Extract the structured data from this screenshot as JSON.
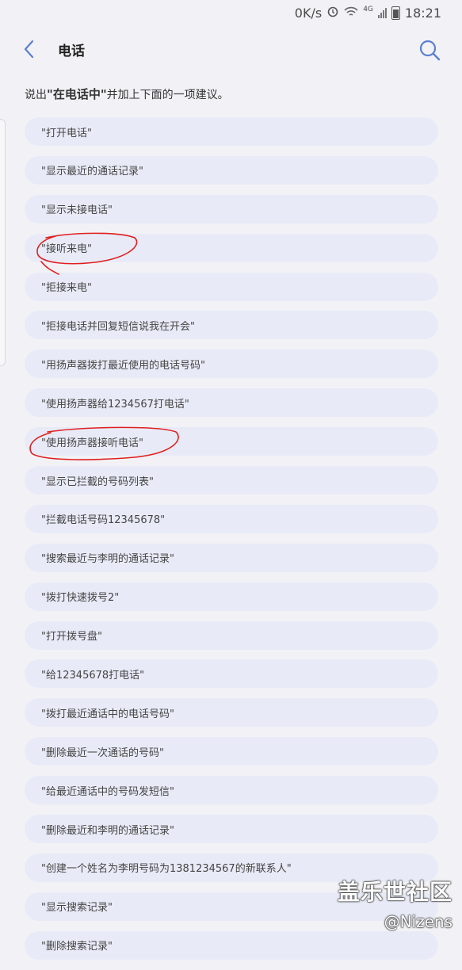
{
  "status": {
    "speed": "0K/s",
    "network": "4G",
    "time": "18:21"
  },
  "header": {
    "title": "电话"
  },
  "hint": {
    "prefix": "说出",
    "keyword": "\"在电话中\"",
    "suffix": "并加上下面的一项建议。"
  },
  "suggestions": [
    "\"打开电话\"",
    "\"显示最近的通话记录\"",
    "\"显示未接电话\"",
    "\"接听来电\"",
    "\"拒接来电\"",
    "\"拒接电话并回复短信说我在开会\"",
    "\"用扬声器拨打最近使用的电话号码\"",
    "\"使用扬声器给1234567打电话\"",
    "\"使用扬声器接听电话\"",
    "\"显示已拦截的号码列表\"",
    "\"拦截电话号码12345678\"",
    "\"搜索最近与李明的通话记录\"",
    "\"拨打快速拨号2\"",
    "\"打开拨号盘\"",
    "\"给12345678打电话\"",
    "\"拨打最近通话中的电话号码\"",
    "\"删除最近一次通话的号码\"",
    "\"给最近通话中的号码发短信\"",
    "\"删除最近和李明的通话记录\"",
    "\"创建一个姓名为李明号码为1381234567的新联系人\"",
    "\"显示搜索记录\"",
    "\"删除搜索记录\""
  ],
  "watermark": {
    "line1": "盖乐世社区",
    "line2": "@Nizens"
  },
  "colors": {
    "accent": "#5b7fd1",
    "chip": "#e8ebf7",
    "annotation": "#e02020"
  }
}
